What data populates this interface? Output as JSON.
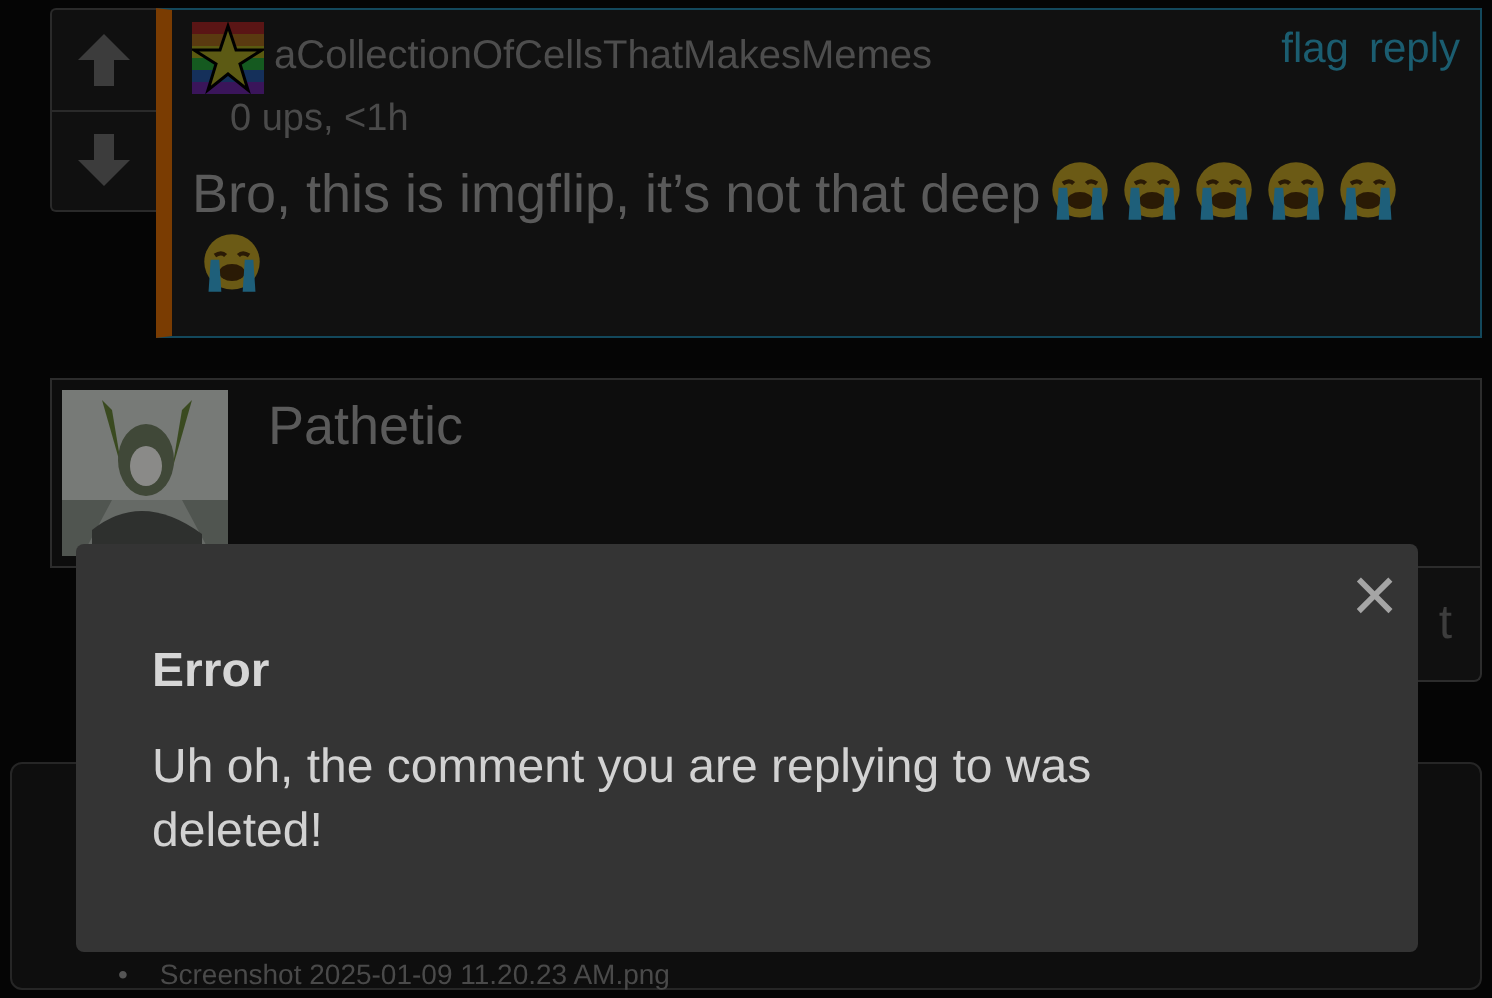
{
  "comment": {
    "username": "aCollectionOfCellsThatMakesMemes",
    "meta": "0 ups, <1h",
    "actions": [
      "flag",
      "reply"
    ],
    "text": "Bro, this is imgflip, it’s not that deep",
    "emojis": [
      {
        "kind": "crying"
      },
      {
        "kind": "crying"
      },
      {
        "kind": "crying"
      },
      {
        "kind": "crying"
      },
      {
        "kind": "crying"
      },
      {
        "kind": "crying"
      }
    ]
  },
  "reply_box": {
    "value": "Pathetic",
    "button_label": "t"
  },
  "attachment": {
    "bullet": "•",
    "filename": "Screenshot 2025-01-09 11.20.23 AM.png"
  },
  "dialog": {
    "close": "×",
    "title": "Error",
    "message": "Uh oh, the comment you are replying to was deleted!"
  }
}
